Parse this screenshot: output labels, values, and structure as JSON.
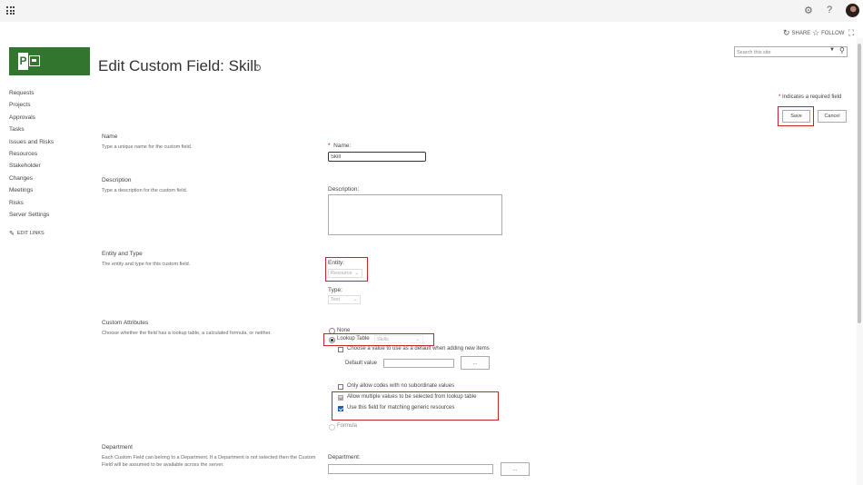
{
  "suite_bar": {
    "app_launcher_icon": "waffle-icon",
    "settings_icon": "gear-icon",
    "help_icon": "question-icon",
    "help_glyph": "?",
    "avatar_icon": "user-avatar"
  },
  "action_bar": {
    "share_label": "SHARE",
    "follow_label": "FOLLOW",
    "share_icon": "share-icon",
    "follow_icon": "star-icon",
    "focus_icon": "focus-icon"
  },
  "search": {
    "placeholder": "Search this site"
  },
  "header": {
    "logo_letter": "P",
    "title": "Edit Custom Field: Skill",
    "info_glyph": "i"
  },
  "quick_launch": {
    "items": [
      "Requests",
      "Projects",
      "Approvals",
      "Tasks",
      "Issues and Risks",
      "Resources",
      "Stakeholder",
      "Changes",
      "Meetings",
      "Risks",
      "Server Settings"
    ],
    "edit_links": "EDIT LINKS"
  },
  "form": {
    "required_star": "*",
    "required_note": " Indicates a required field",
    "save_label": "Save",
    "cancel_label": "Cancel",
    "name": {
      "title": "Name",
      "desc": "Type a unique name for the custom field.",
      "label": "Name:",
      "value": "Skill"
    },
    "description": {
      "title": "Description",
      "desc": "Type a description for the custom field.",
      "label": "Description:",
      "value": ""
    },
    "entity_type": {
      "title": "Entity and Type",
      "desc": "The entity and type for this custom field.",
      "entity_label": "Entity:",
      "entity_value": "Resource",
      "type_label": "Type:",
      "type_value": "Text"
    },
    "custom_attributes": {
      "title": "Custom Attributes",
      "desc": "Choose whether the field has a lookup table, a calculated formula, or neither.",
      "none_label": "None",
      "lookup_label": "Lookup Table",
      "lookup_value": "Skills",
      "default_checkbox_label": "Choose a value to use as a default when adding new items",
      "default_value_label": "Default value",
      "default_value": "",
      "browse_label": "...",
      "only_codes_label": "Only allow codes with no subordinate values",
      "allow_multiple_label": "Allow multiple values to be selected from lookup table",
      "generic_label": "Use this field for matching generic resources",
      "formula_label": "Formula"
    },
    "department": {
      "title": "Department",
      "desc": "Each Custom Field can belong to a Department. If a Department is not selected then the Custom Field will be assumed to be available across the server.",
      "label": "Department:",
      "value": "",
      "browse_label": "..."
    }
  },
  "colors": {
    "accent_red": "#c4262e",
    "project_green": "#31752f",
    "checkbox_blue": "#1a5fb4"
  }
}
